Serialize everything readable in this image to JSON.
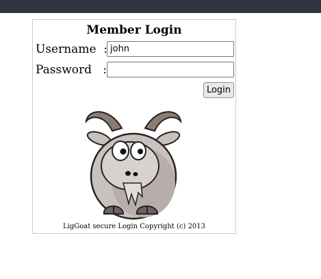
{
  "login": {
    "title": "Member Login",
    "username_label": "Username  :",
    "username_value": "john",
    "password_label": "Password   :",
    "password_value": "",
    "login_button": "Login",
    "footer": "LigGoat secure Login Copyright (c) 2013"
  },
  "colors": {
    "topbar": "#2f343f",
    "goat_body": "#c8c1bd",
    "goat_horn": "#8a7b73"
  },
  "icons": {
    "mascot": "goat-mascot-icon"
  }
}
